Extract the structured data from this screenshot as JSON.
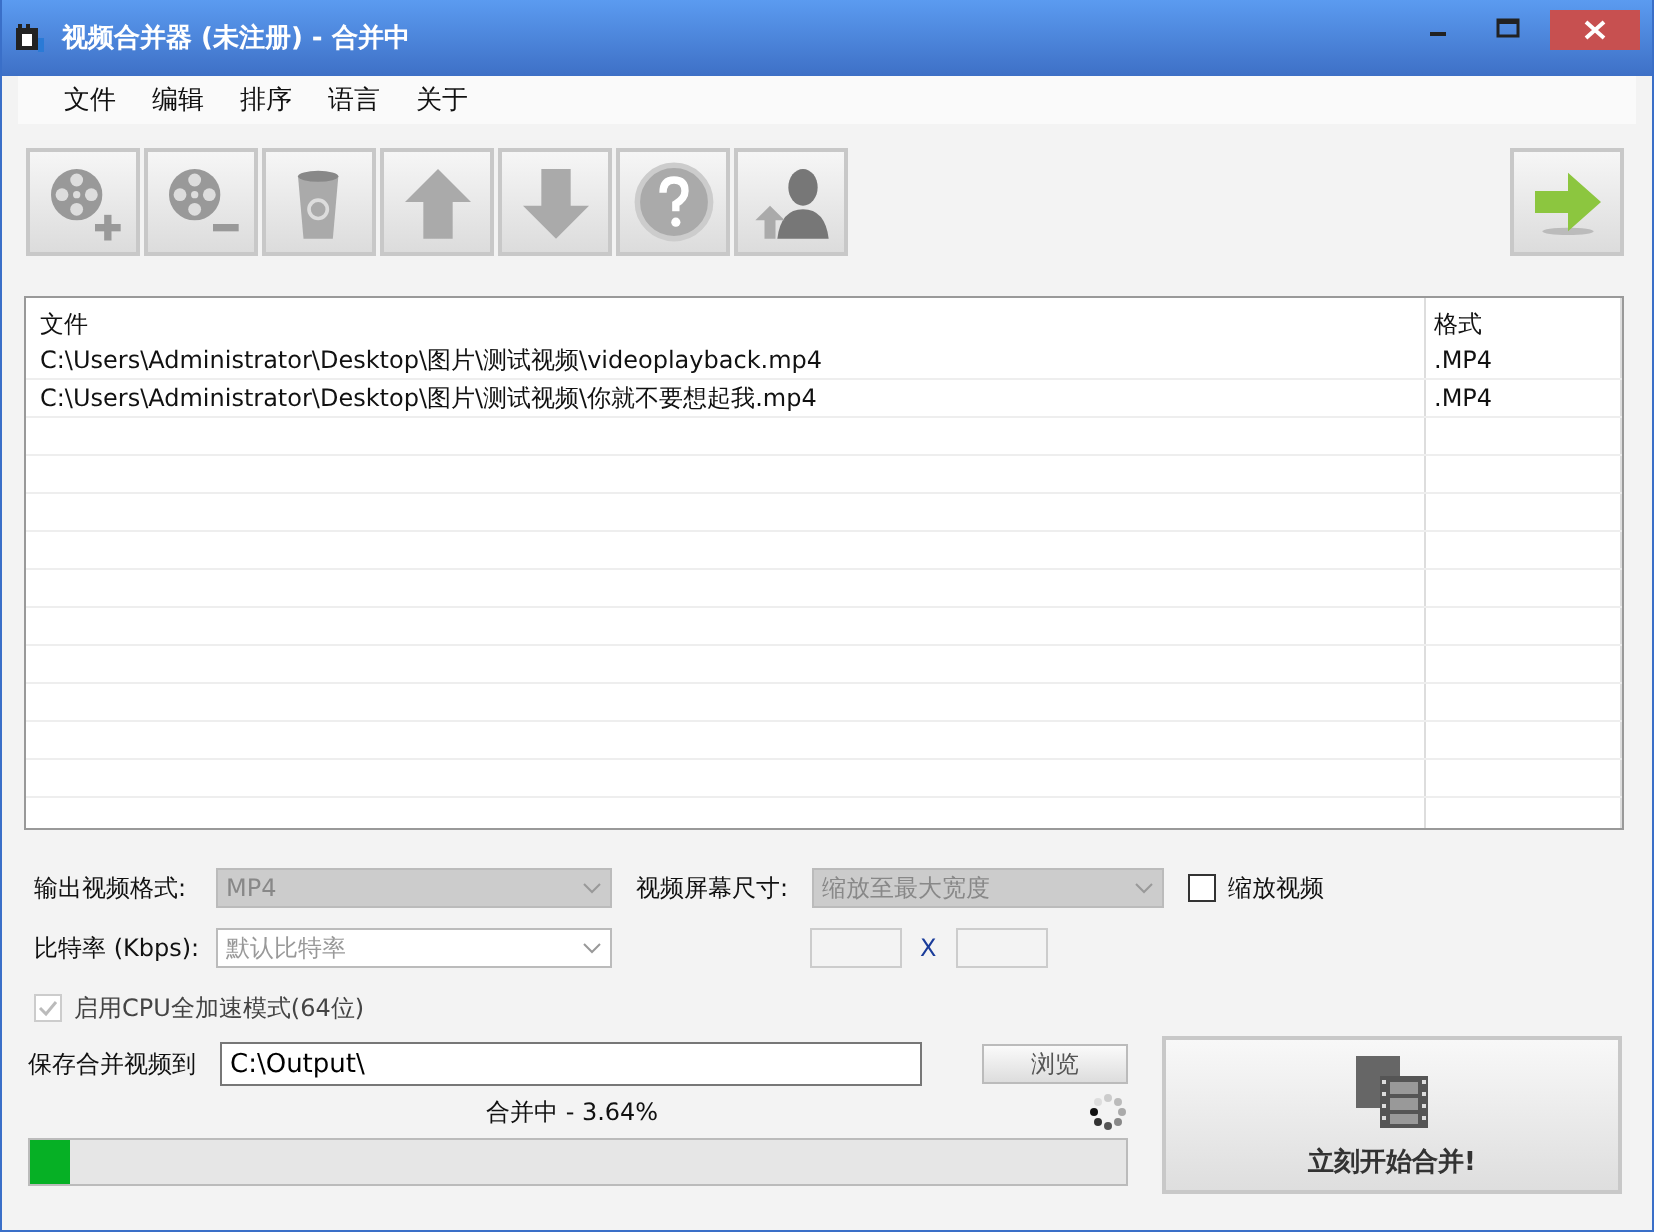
{
  "window": {
    "title": "视频合并器 (未注册) - 合并中"
  },
  "menu": [
    "文件",
    "编辑",
    "排序",
    "语言",
    "关于"
  ],
  "toolbar": [
    {
      "kind": "add-video"
    },
    {
      "kind": "remove-video"
    },
    {
      "kind": "trash"
    },
    {
      "kind": "up"
    },
    {
      "kind": "down"
    },
    {
      "kind": "help"
    },
    {
      "kind": "user"
    },
    {
      "kind": "go"
    }
  ],
  "table": {
    "columns": [
      "文件",
      "格式"
    ],
    "rows": [
      [
        "C:\\Users\\Administrator\\Desktop\\图片\\测试视频\\videoplayback.mp4",
        ".MP4"
      ],
      [
        "C:\\Users\\Administrator\\Desktop\\图片\\测试视频\\你就不要想起我.mp4",
        ".MP4"
      ]
    ]
  },
  "output_format": {
    "label": "输出视频格式:",
    "value": "MP4",
    "disabled": true
  },
  "screen_size": {
    "label": "视频屏幕尺寸:",
    "value": "缩放至最大宽度",
    "disabled": true
  },
  "scale_video": {
    "label": "缩放视频",
    "checked": false
  },
  "bitrate": {
    "label": "比特率 (Kbps):",
    "value": "默认比特率",
    "disabled": false
  },
  "size_separator": "X",
  "cpu_mode": {
    "label": "启用CPU全加速模式(64位)",
    "checked": true,
    "disabled": true
  },
  "save": {
    "label": "保存合并视频到",
    "value": "C:\\Output\\",
    "browse": "浏览"
  },
  "progress": {
    "status": "合并中 - 3.64%",
    "level": 0.0364
  },
  "start_button": "立刻开始合并!"
}
